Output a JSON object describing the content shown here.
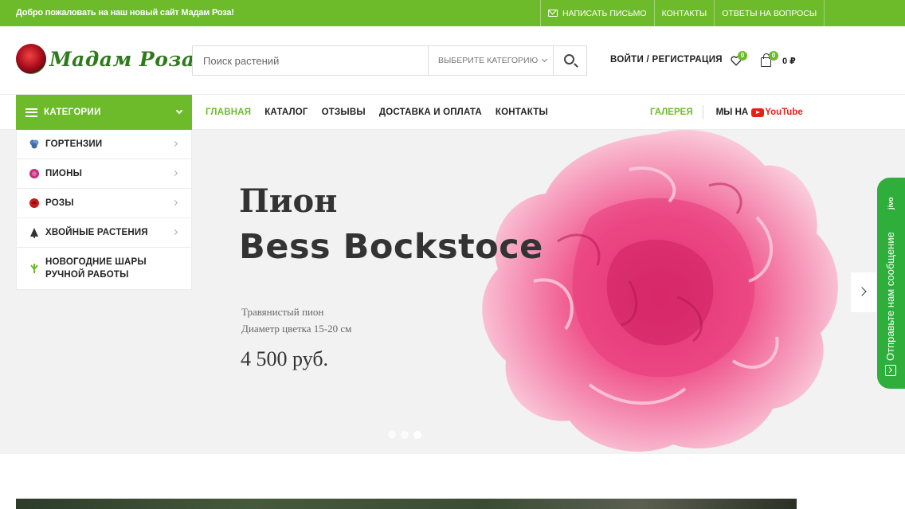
{
  "topbar": {
    "welcome": "Добро пожаловать на наш новый сайт Мадам Роза!",
    "links": [
      "НАПИСАТЬ ПИСЬМО",
      "КОНТАКТЫ",
      "ОТВЕТЫ НА ВОПРОСЫ"
    ]
  },
  "header": {
    "brand": "Мадам Роза",
    "search_placeholder": "Поиск растений",
    "category_select": "ВЫБЕРИТЕ КАТЕГОРИЮ",
    "login": "ВОЙТИ / РЕГИСТРАЦИЯ",
    "wishlist_count": "0",
    "cart_count": "0",
    "cart_total": "0 ₽"
  },
  "nav": {
    "categories_button": "КАТЕГОРИИ",
    "menu": [
      "ГЛАВНАЯ",
      "КАТАЛОГ",
      "ОТЗЫВЫ",
      "ДОСТАВКА И ОПЛАТА",
      "КОНТАКТЫ"
    ],
    "gallery": "ГАЛЕРЕЯ",
    "youtube_prefix": "МЫ НА",
    "youtube": "YouTube"
  },
  "categories": [
    {
      "label": "ГОРТЕНЗИИ",
      "icon": "hydrangea-icon",
      "color": "#4a78b8"
    },
    {
      "label": "ПИОНЫ",
      "icon": "peony-icon",
      "color": "#c2307a"
    },
    {
      "label": "РОЗЫ",
      "icon": "rose-icon",
      "color": "#c51b1b"
    },
    {
      "label": "ХВОЙНЫЕ РАСТЕНИЯ",
      "icon": "conifer-icon",
      "color": "#333333"
    },
    {
      "label": "НОВОГОДНИЕ ШАРЫ РУЧНОЙ РАБОТЫ",
      "icon": "sprout-icon",
      "color": "#6dbb2b"
    }
  ],
  "hero": {
    "title_line1": "Пион",
    "title_line2": "Bess Bockstoce",
    "desc1": "Травянистый пион",
    "desc2": "Диаметр цветка 15-20 см",
    "price": "4 500 руб."
  },
  "jivo": {
    "label": "Отправьте нам сообщение",
    "logo": "jivo"
  },
  "colors": {
    "accent": "#6dbb2b",
    "jivo": "#2fae3b",
    "youtube": "#e62117"
  }
}
